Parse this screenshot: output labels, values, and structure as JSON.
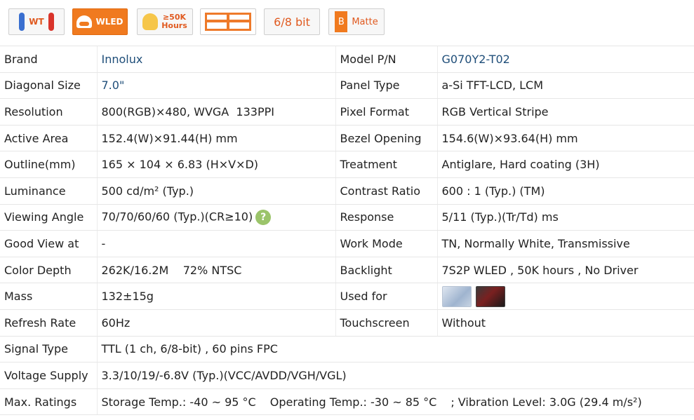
{
  "badges": {
    "wt": "WT",
    "wled": "WLED",
    "hours_line1": "≥50K",
    "hours_line2": "Hours",
    "bits": "6/8 bit",
    "matte_letter": "B",
    "matte": "Matte"
  },
  "specs": {
    "brand_label": "Brand",
    "brand": "Innolux",
    "model_label": "Model P/N",
    "model": "G070Y2-T02",
    "diag_label": "Diagonal Size",
    "diag": "7.0\"",
    "paneltype_label": "Panel Type",
    "paneltype": "a-Si TFT-LCD, LCM",
    "res_label": "Resolution",
    "res": "800(RGB)×480, WVGA  133PPI",
    "pixfmt_label": "Pixel Format",
    "pixfmt": "RGB Vertical Stripe",
    "active_label": "Active Area",
    "active": "152.4(W)×91.44(H) mm",
    "bezel_label": "Bezel Opening",
    "bezel": "154.6(W)×93.64(H) mm",
    "outline_label": "Outline(mm)",
    "outline": "165 × 104 × 6.83 (H×V×D)",
    "treat_label": "Treatment",
    "treat": "Antiglare, Hard coating (3H)",
    "lum_label": "Luminance",
    "lum": "500 cd/m² (Typ.)",
    "contrast_label": "Contrast Ratio",
    "contrast": "600 : 1 (Typ.) (TM)",
    "view_label": "Viewing Angle",
    "view": "70/70/60/60 (Typ.)(CR≥10)",
    "help_glyph": "?",
    "resp_label": "Response",
    "resp": "5/11 (Typ.)(Tr/Td) ms",
    "goodview_label": "Good View at",
    "goodview": "-",
    "work_label": "Work Mode",
    "work": "TN, Normally White, Transmissive",
    "color_label": "Color Depth",
    "color": "262K/16.2M    72% NTSC",
    "backlight_label": "Backlight",
    "backlight": "7S2P WLED , 50K hours , No Driver",
    "mass_label": "Mass",
    "mass": "132±15g",
    "usedfor_label": "Used for",
    "refresh_label": "Refresh Rate",
    "refresh": "60Hz",
    "touch_label": "Touchscreen",
    "touch": "Without",
    "signal_label": "Signal Type",
    "signal": "TTL (1 ch, 6/8-bit) , 60 pins FPC",
    "voltage_label": "Voltage Supply",
    "voltage": "3.3/10/19/-6.8V (Typ.)(VCC/AVDD/VGH/VGL)",
    "max_label": "Max. Ratings",
    "max_storage": "Storage Temp.: -40 ~ 95 °C",
    "max_operating": "Operating Temp.: -30 ~ 85 °C",
    "max_vibration": "; Vibration Level: 3.0G (29.4 m/s²)"
  },
  "colors": {
    "accent": "#f07a1f",
    "link": "#1f4e79",
    "help": "#9bc46a"
  },
  "icons": [
    "thermometer-icon",
    "led-lamp-icon",
    "bulb-icon",
    "panel-layout-icon",
    "matte-icon",
    "help-icon"
  ]
}
